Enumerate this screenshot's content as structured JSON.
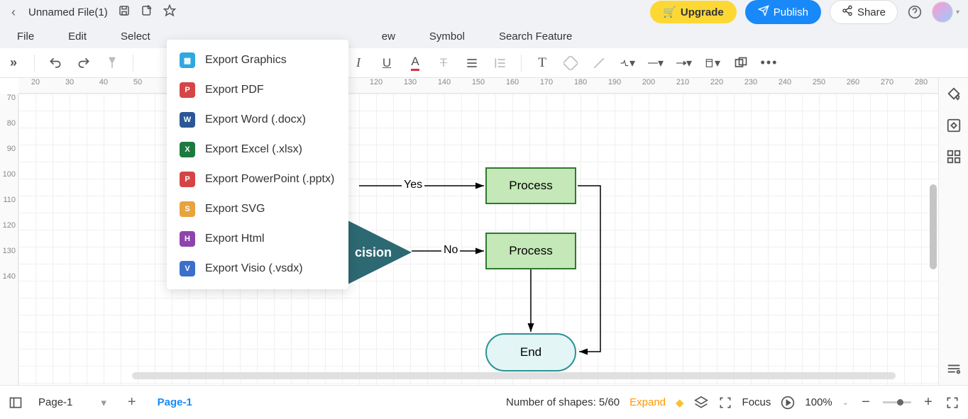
{
  "title": {
    "filename": "Unnamed File(1)"
  },
  "header": {
    "upgrade": "Upgrade",
    "publish": "Publish",
    "share": "Share"
  },
  "menu": {
    "file": "File",
    "edit": "Edit",
    "select": "Select",
    "view_partial": "ew",
    "symbol": "Symbol",
    "search": "Search Feature"
  },
  "export_menu": [
    {
      "label": "Export Graphics",
      "color": "#2fa8e0",
      "tag": "G"
    },
    {
      "label": "Export PDF",
      "color": "#d64545",
      "tag": "P"
    },
    {
      "label": "Export Word (.docx)",
      "color": "#2b5797",
      "tag": "W"
    },
    {
      "label": "Export Excel (.xlsx)",
      "color": "#1e7a3e",
      "tag": "X"
    },
    {
      "label": "Export PowerPoint (.pptx)",
      "color": "#d64545",
      "tag": "P"
    },
    {
      "label": "Export SVG",
      "color": "#e8a33d",
      "tag": "S"
    },
    {
      "label": "Export Html",
      "color": "#8e44ad",
      "tag": "H"
    },
    {
      "label": "Export Visio (.vsdx)",
      "color": "#3b6fc9",
      "tag": "V"
    }
  ],
  "ruler_h": [
    "20",
    "30",
    "40",
    "50",
    "",
    "",
    "",
    "",
    "",
    "",
    "120",
    "130",
    "140",
    "150",
    "160",
    "170",
    "180",
    "190",
    "200",
    "210",
    "220",
    "230",
    "240",
    "250",
    "260",
    "270",
    "280"
  ],
  "ruler_v": [
    "70",
    "80",
    "90",
    "100",
    "110",
    "120",
    "130",
    "140"
  ],
  "flow": {
    "decision": "cision",
    "yes": "Yes",
    "no": "No",
    "process1": "Process",
    "process2": "Process",
    "end": "End"
  },
  "bottom": {
    "page_selector": "Page-1",
    "page_tab": "Page-1",
    "shapes_label": "Number of shapes: 5/60",
    "expand": "Expand",
    "focus": "Focus",
    "zoom": "100%"
  }
}
